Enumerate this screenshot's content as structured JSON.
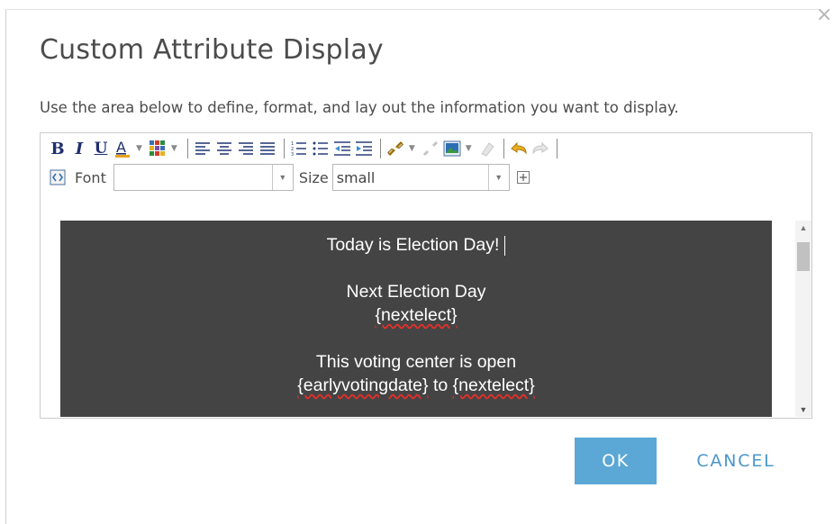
{
  "dialog": {
    "title": "Custom Attribute Display",
    "description": "Use the area below to define, format, and lay out the information you want to display.",
    "close_glyph": "×"
  },
  "toolbar": {
    "bold": "B",
    "italic": "I",
    "underline": "U",
    "font_label": "Font",
    "font_value": "",
    "size_label": "Size",
    "size_value": "small",
    "dropdown_glyph": "▼"
  },
  "content": {
    "line1": "Today is Election Day!",
    "line2": "Next Election Day",
    "line3": "{nextelect}",
    "line4": "This voting center is open",
    "line5_a": "{earlyvotingdate}",
    "line5_b": " to ",
    "line5_c": "{nextelect}"
  },
  "buttons": {
    "ok": "OK",
    "cancel": "CANCEL"
  },
  "colors": {
    "accent": "#5ba7d6",
    "content_bg": "#444444",
    "cancel_text": "#4b97c9"
  },
  "icons": [
    "bold-icon",
    "italic-icon",
    "underline-icon",
    "font-color-icon",
    "background-color-icon",
    "align-left-icon",
    "align-center-icon",
    "align-right-icon",
    "justify-icon",
    "numbered-list-icon",
    "bullet-list-icon",
    "outdent-icon",
    "indent-icon",
    "link-icon",
    "unlink-icon",
    "insert-image-icon",
    "eraser-icon",
    "undo-icon",
    "redo-icon",
    "html-source-icon",
    "expand-icon"
  ]
}
